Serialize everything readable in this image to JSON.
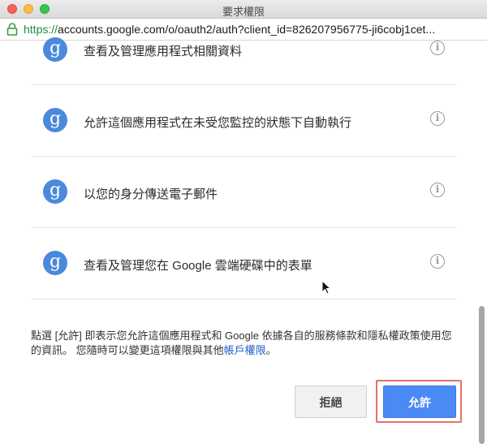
{
  "window": {
    "title": "要求權限"
  },
  "urlbar": {
    "scheme": "https://",
    "rest": "accounts.google.com/o/oauth2/auth?client_id=826207956775-ji6cobj1cet..."
  },
  "permissions": [
    {
      "label": "查看及管理應用程式相關資料",
      "icon": "g"
    },
    {
      "label": "允許這個應用程式在未受您監控的狀態下自動執行",
      "icon": "g"
    },
    {
      "label": "以您的身分傳送電子郵件",
      "icon": "g"
    },
    {
      "label": "查看及管理您在 Google 雲端硬碟中的表單",
      "icon": "g"
    }
  ],
  "info_glyph": "i",
  "disclaimer": {
    "text_before": "點選 [允許] 即表示您允許這個應用程式和 Google 依據各自的服務條款和隱私權政策使用您的資訊。 您隨時可以變更這項權限與其他",
    "link": "帳戶權限",
    "text_after": "。"
  },
  "buttons": {
    "deny": "拒絕",
    "allow": "允許"
  },
  "colors": {
    "accent_blue": "#4a8af4",
    "g_icon_blue": "#4a89dc",
    "link_blue": "#1a5fc8",
    "highlight_red": "#e3716a",
    "secure_green": "#1e8e3e"
  }
}
